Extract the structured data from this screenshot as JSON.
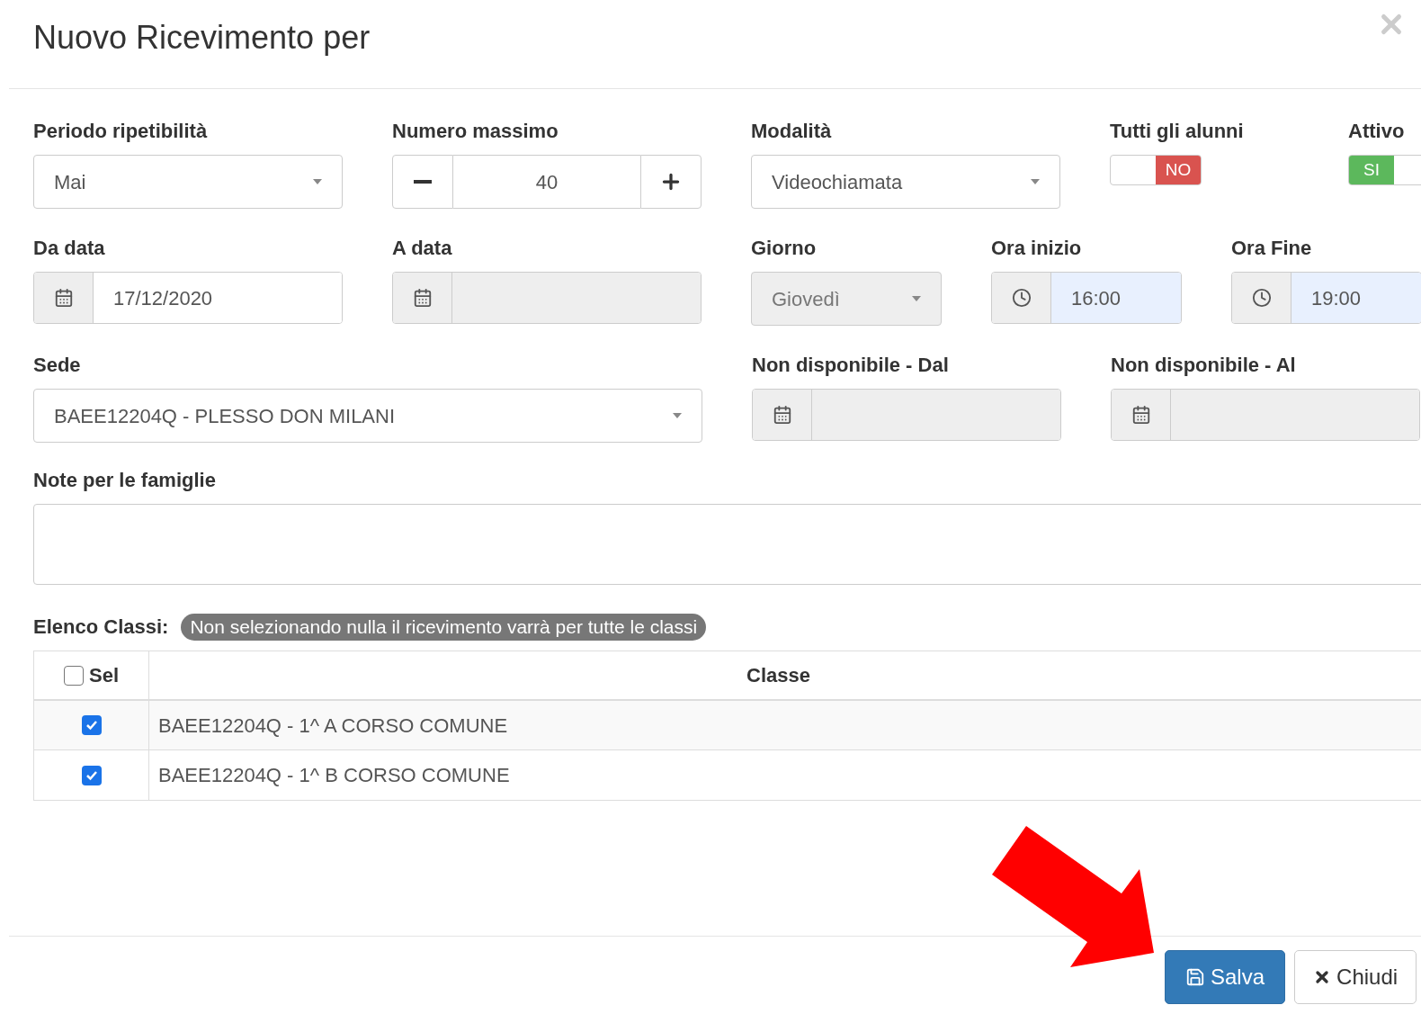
{
  "dialog": {
    "title": "Nuovo Ricevimento per"
  },
  "rows": [
    [
      {
        "kind": "select",
        "label": "Periodo ripetibilità",
        "value": "Mai",
        "disabled": false
      },
      {
        "kind": "stepper",
        "label": "Numero massimo",
        "value": "40"
      },
      {
        "kind": "select",
        "label": "Modalità",
        "value": "Videochiamata",
        "disabled": false
      },
      {
        "kind": "toggle",
        "label": "Tutti gli alunni",
        "on": false,
        "text": "NO"
      },
      {
        "kind": "toggle",
        "label": "Attivo",
        "on": true,
        "text": "SI"
      }
    ],
    [
      {
        "kind": "date",
        "label": "Da data",
        "value": "17/12/2020",
        "disabled": false
      },
      {
        "kind": "date",
        "label": "A data",
        "disabled": true
      },
      {
        "kind": "select",
        "label": "Giorno",
        "value": "Giovedì",
        "disabled": true
      },
      {
        "kind": "time",
        "label": "Ora inizio",
        "value": "16:00"
      },
      {
        "kind": "time",
        "label": "Ora Fine",
        "value": "19:00"
      }
    ],
    [
      {
        "kind": "select",
        "label": "Sede",
        "value": "BAEE12204Q - PLESSO DON MILANI",
        "disabled": false
      },
      {
        "kind": "date",
        "label": "Non disponibile - Dal",
        "disabled": true
      },
      {
        "kind": "date",
        "label": "Non disponibile - Al",
        "disabled": true
      }
    ]
  ],
  "notes": {
    "label": "Note per le famiglie"
  },
  "classes": {
    "label": "Elenco Classi:",
    "badge": "Non selezionando nulla il ricevimento varrà per tutte le classi",
    "header": {
      "sel": "Sel",
      "checked": false,
      "classe": "Classe"
    },
    "rows": [
      {
        "name": "BAEE12204Q - 1^ A CORSO COMUNE",
        "checked": true
      },
      {
        "name": "BAEE12204Q - 1^ B CORSO COMUNE",
        "checked": true
      }
    ]
  },
  "buttons": [
    {
      "kind": "primary",
      "label": "Salva"
    },
    {
      "kind": "default",
      "label": "Chiudi"
    }
  ]
}
